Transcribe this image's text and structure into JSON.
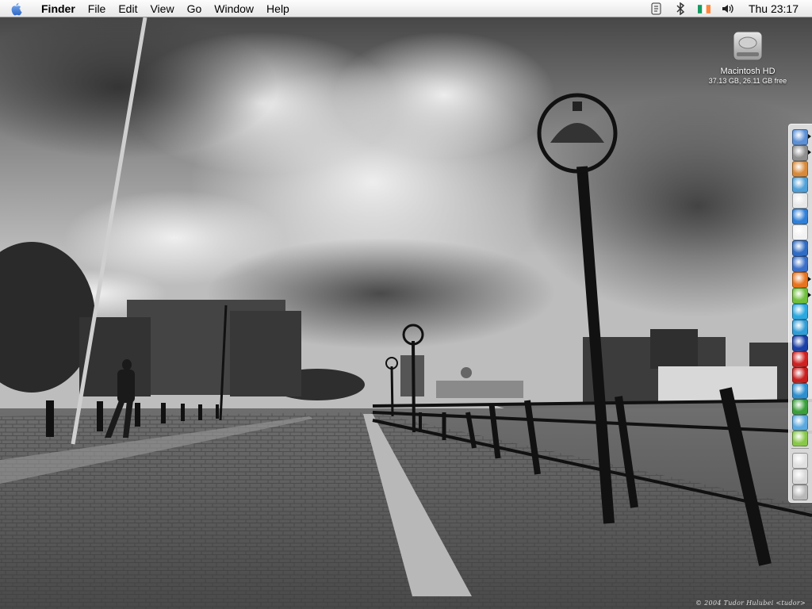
{
  "menubar": {
    "app_name": "Finder",
    "menus": [
      "File",
      "Edit",
      "View",
      "Go",
      "Window",
      "Help"
    ],
    "extras": [
      "script-menu-icon",
      "bluetooth-icon",
      "ireland-flag-icon",
      "volume-icon"
    ],
    "clock": "Thu 23:17"
  },
  "desktop": {
    "icons": [
      {
        "name": "Macintosh HD",
        "info": "37.13 GB, 26.11 GB free"
      }
    ],
    "wallpaper_credit": "© 2004 Tudor Hulubei <tudor>"
  },
  "dock": {
    "position": "right",
    "items": [
      {
        "name": "finder",
        "color": "#5b8fd6",
        "running": true
      },
      {
        "name": "system-preferences",
        "color": "#8e8e8e",
        "running": true
      },
      {
        "name": "iphoto",
        "color": "#d88a3a",
        "running": false
      },
      {
        "name": "preview",
        "color": "#4fa0d8",
        "running": false
      },
      {
        "name": "ical",
        "color": "#e8e8e8",
        "running": false
      },
      {
        "name": "safari",
        "color": "#2f7fd8",
        "running": false
      },
      {
        "name": "textedit",
        "color": "#f2f2f2",
        "running": false
      },
      {
        "name": "microsoft-word",
        "color": "#2f6cc4",
        "running": false
      },
      {
        "name": "network-utility",
        "color": "#3a6fc8",
        "running": false
      },
      {
        "name": "firefox",
        "color": "#e8731e",
        "running": true
      },
      {
        "name": "adium",
        "color": "#6fbf3a",
        "running": true
      },
      {
        "name": "skype",
        "color": "#2aa8e0",
        "running": false
      },
      {
        "name": "chat",
        "color": "#2e9cd6",
        "running": false
      },
      {
        "name": "dashboard",
        "color": "#1a3fa8",
        "running": false
      },
      {
        "name": "no-entry",
        "color": "#d02020",
        "running": false
      },
      {
        "name": "acrobat",
        "color": "#c81e1e",
        "running": false
      },
      {
        "name": "quicktime",
        "color": "#2d8fd0",
        "running": false
      },
      {
        "name": "utility-app",
        "color": "#3a9f3a",
        "running": false
      },
      {
        "name": "itunes",
        "color": "#5aa8e0",
        "running": false
      },
      {
        "name": "stickies",
        "color": "#88c848",
        "running": false
      },
      {
        "name": "documents-stack",
        "color": "#e0e0e0",
        "running": false
      },
      {
        "name": "downloads-stack",
        "color": "#d8d8d8",
        "running": false
      },
      {
        "name": "trash",
        "color": "#b8b8b8",
        "running": false
      }
    ]
  }
}
